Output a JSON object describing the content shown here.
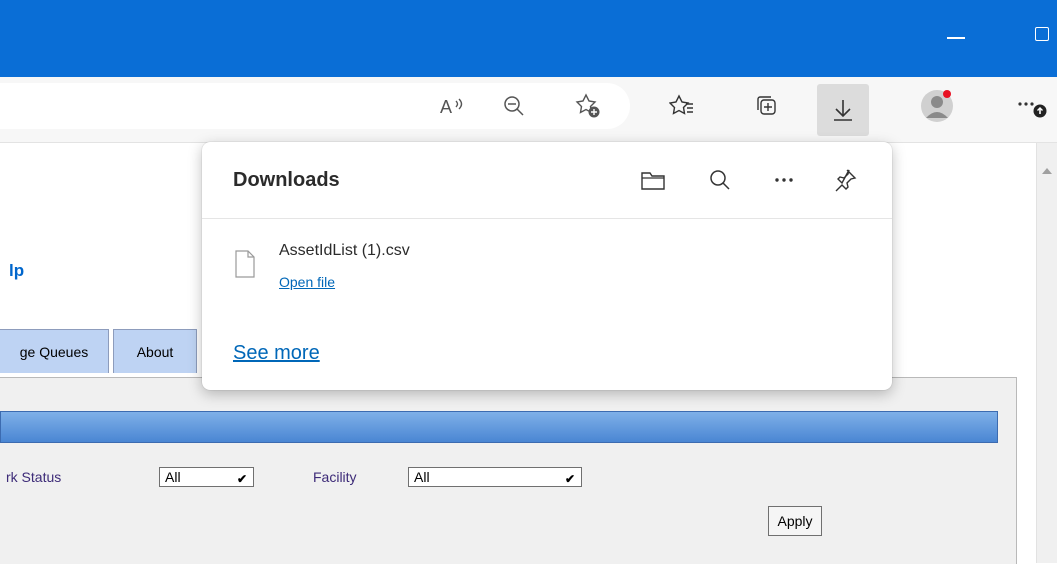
{
  "browser": {
    "toolbar_icons": [
      {
        "name": "read-aloud-icon",
        "glyph": "A⁾"
      },
      {
        "name": "zoom-out-icon",
        "glyph": "⊖"
      },
      {
        "name": "add-favorite-icon",
        "glyph": "☆"
      },
      {
        "name": "favorites-icon",
        "glyph": "☆"
      },
      {
        "name": "collections-icon",
        "glyph": "⧉"
      },
      {
        "name": "downloads-icon",
        "glyph": "↓"
      },
      {
        "name": "profile-icon",
        "glyph": "●"
      },
      {
        "name": "more-icon",
        "glyph": "⋯"
      }
    ],
    "accent": "#0a6ed6"
  },
  "page": {
    "title_fragment": "lp",
    "tabs": [
      {
        "label": "ge Queues"
      },
      {
        "label": "About"
      }
    ],
    "filters": {
      "work_status_label": "rk Status",
      "work_status_value": "All",
      "facility_label": "Facility",
      "facility_value": "All",
      "apply_label": "Apply"
    }
  },
  "downloads_panel": {
    "title": "Downloads",
    "header_icons": [
      "folder-icon",
      "search-icon",
      "more-options-icon",
      "pin-icon"
    ],
    "items": [
      {
        "file_name": "AssetIdList (1).csv",
        "action": "Open file"
      }
    ],
    "see_more": "See more",
    "link_color": "#0067b8"
  }
}
